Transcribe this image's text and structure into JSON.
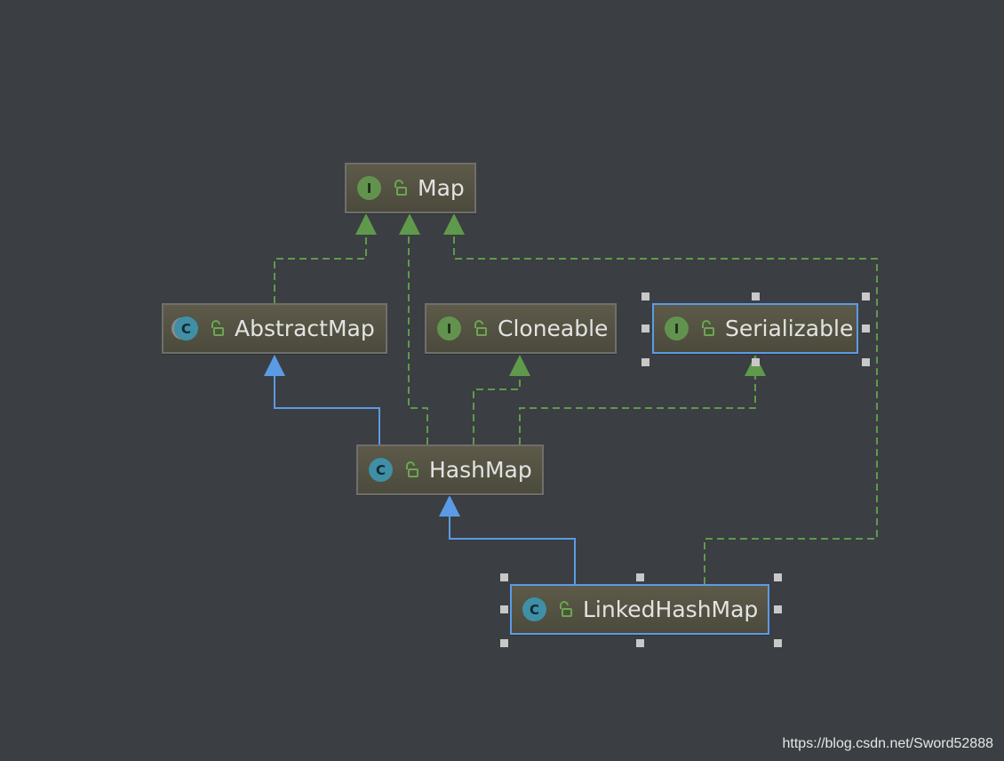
{
  "nodes": {
    "map": {
      "label": "Map",
      "kind": "interface",
      "badge": "I"
    },
    "abstract_map": {
      "label": "AbstractMap",
      "kind": "abstract-class",
      "badge": "C"
    },
    "cloneable": {
      "label": "Cloneable",
      "kind": "interface",
      "badge": "I"
    },
    "serializable": {
      "label": "Serializable",
      "kind": "interface",
      "badge": "I"
    },
    "hash_map": {
      "label": "HashMap",
      "kind": "class",
      "badge": "C"
    },
    "linked_hash_map": {
      "label": "LinkedHashMap",
      "kind": "class",
      "badge": "C"
    }
  },
  "edges": [
    {
      "from": "AbstractMap",
      "to": "Map",
      "type": "implements"
    },
    {
      "from": "HashMap",
      "to": "Map",
      "type": "implements"
    },
    {
      "from": "LinkedHashMap",
      "to": "Map",
      "type": "implements"
    },
    {
      "from": "HashMap",
      "to": "AbstractMap",
      "type": "extends"
    },
    {
      "from": "HashMap",
      "to": "Cloneable",
      "type": "implements"
    },
    {
      "from": "HashMap",
      "to": "Serializable",
      "type": "implements"
    },
    {
      "from": "LinkedHashMap",
      "to": "HashMap",
      "type": "extends"
    }
  ],
  "colors": {
    "background": "#3b3e42",
    "implements_edge": "#5f9a4c",
    "extends_edge": "#5b9be6",
    "selection": "#5b9be6"
  },
  "icons": {
    "visibility": "open-lock-icon"
  },
  "watermark": "https://blog.csdn.net/Sword52888"
}
